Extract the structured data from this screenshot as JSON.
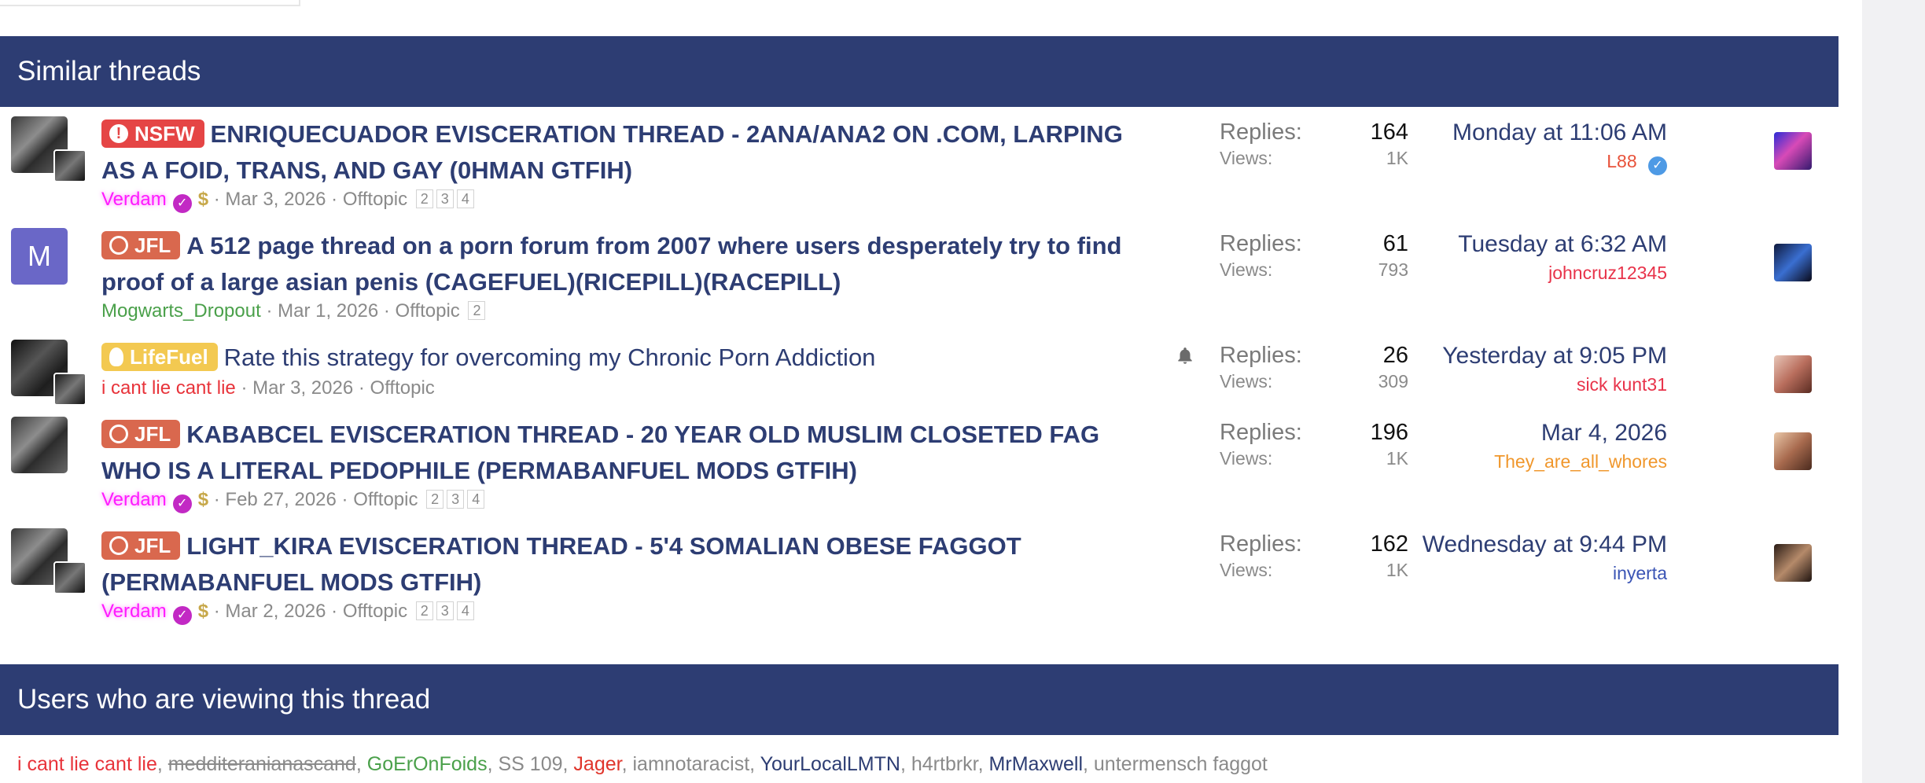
{
  "similar_threads": {
    "heading": "Similar threads",
    "replies_label": "Replies:",
    "views_label": "Views:",
    "threads": [
      {
        "prefix": "NSFW",
        "title_line1": "ENRIQUECUADOR EVISCERATION THREAD - 2ANA/ANA2 ON .COM, LARPING",
        "title_line2": "AS A FOID, TRANS, AND GAY (0HMAN GTFIH)",
        "author": "Verdam",
        "date": "Mar 3, 2026",
        "forum": "Offtopic",
        "pages": [
          "2",
          "3",
          "4"
        ],
        "replies": "164",
        "views": "1K",
        "latest_date": "Monday at 11:06 AM",
        "latest_user": "L88"
      },
      {
        "prefix": "JFL",
        "title_line1": "A 512 page thread on a porn forum from 2007 where users desperately try to find",
        "title_line2": "proof of a large asian penis (CAGEFUEL)(RICEPILL)(RACEPILL)",
        "author": "Mogwarts_Dropout",
        "avatar_letter": "M",
        "date": "Mar 1, 2026",
        "forum": "Offtopic",
        "pages": [
          "2"
        ],
        "replies": "61",
        "views": "793",
        "latest_date": "Tuesday at 6:32 AM",
        "latest_user": "johncruz12345"
      },
      {
        "prefix": "LifeFuel",
        "title_line1": "Rate this strategy for overcoming my Chronic Porn Addiction",
        "author": "i cant lie cant lie",
        "date": "Mar 3, 2026",
        "forum": "Offtopic",
        "replies": "26",
        "views": "309",
        "latest_date": "Yesterday at 9:05 PM",
        "latest_user": "sick kunt31"
      },
      {
        "prefix": "JFL",
        "title_line1": "KABABCEL EVISCERATION THREAD - 20 YEAR OLD MUSLIM CLOSETED FAG",
        "title_line2": "WHO IS A LITERAL PEDOPHILE (PERMABANFUEL MODS GTFIH)",
        "author": "Verdam",
        "date": "Feb 27, 2026",
        "forum": "Offtopic",
        "pages": [
          "2",
          "3",
          "4"
        ],
        "replies": "196",
        "views": "1K",
        "latest_date": "Mar 4, 2026",
        "latest_user": "They_are_all_whores"
      },
      {
        "prefix": "JFL",
        "title_line1": "LIGHT_KIRA EVISCERATION THREAD - 5'4 SOMALIAN OBESE FAGGOT",
        "title_line2": "(PERMABANFUEL MODS GTFIH)",
        "author": "Verdam",
        "date": "Mar 2, 2026",
        "forum": "Offtopic",
        "pages": [
          "2",
          "3",
          "4"
        ],
        "replies": "162",
        "views": "1K",
        "latest_date": "Wednesday at 9:44 PM",
        "latest_user": "inyerta"
      }
    ]
  },
  "viewers": {
    "heading": "Users who are viewing this thread",
    "users": [
      "i cant lie cant lie",
      "medditeranianascand",
      "GoErOnFoids",
      "SS 109",
      "Jager",
      "iamnotaracist",
      "YourLocalLMTN",
      "h4rtbrkr",
      "MrMaxwell",
      "untermensch faggot"
    ],
    "separator": ", "
  },
  "colors": {
    "header_bg": "#2d3d73",
    "nsfw": "#e54545",
    "jfl": "#d9684e",
    "lifefuel": "#f3c951",
    "verdam": "#ff1aff"
  }
}
